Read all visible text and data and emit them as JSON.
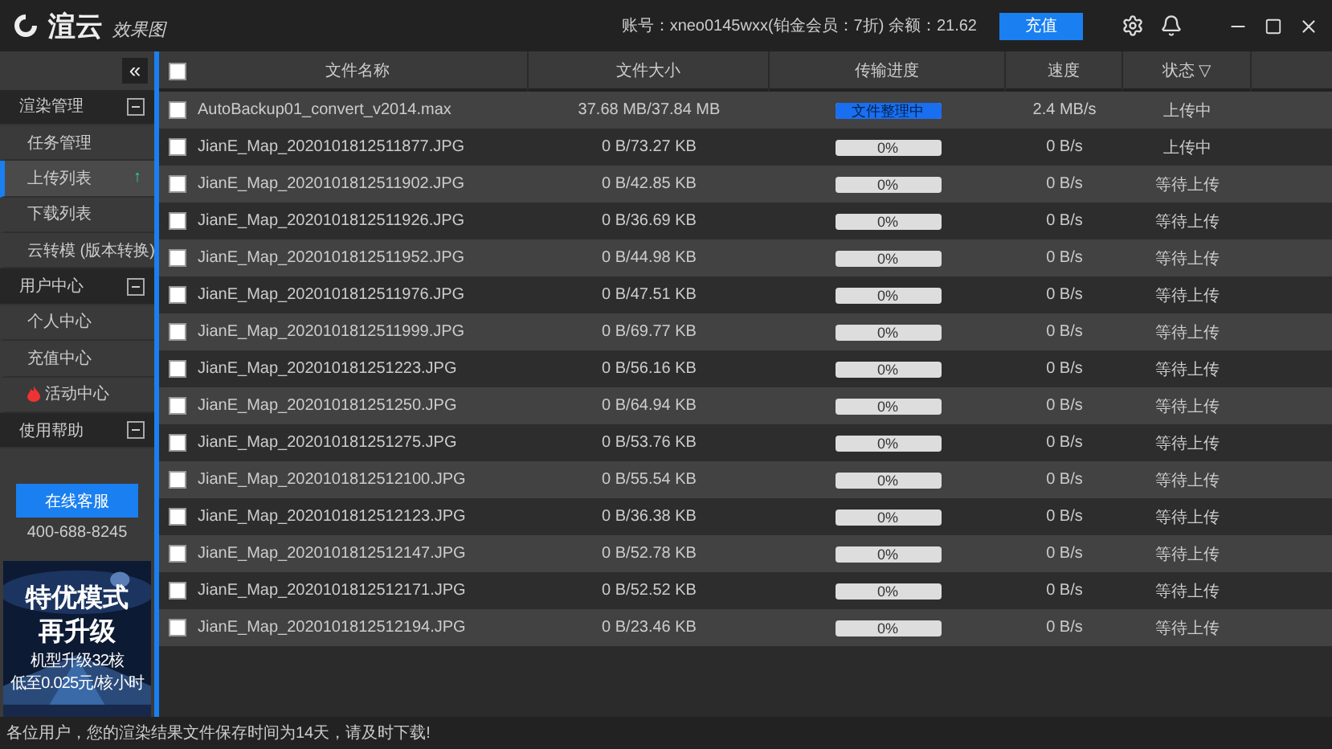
{
  "titlebar": {
    "logo": "渲云",
    "subtitle": "效果图",
    "account": "账号：xneo0145wxx(铂金会员：7折) 余额：21.62",
    "recharge": "充值"
  },
  "sidebar": {
    "collapse": "«",
    "groups": [
      {
        "label": "渲染管理",
        "expanded": true,
        "items": [
          {
            "label": "任务管理",
            "selected": false
          },
          {
            "label": "上传列表",
            "selected": true,
            "badge": "↑"
          },
          {
            "label": "下载列表",
            "selected": false
          },
          {
            "label": "云转模 (版本转换)",
            "selected": false
          }
        ]
      },
      {
        "label": "用户中心",
        "expanded": true,
        "items": [
          {
            "label": "个人中心",
            "selected": false
          },
          {
            "label": "充值中心",
            "selected": false
          },
          {
            "label": "活动中心",
            "selected": false,
            "hot": true
          }
        ]
      },
      {
        "label": "使用帮助",
        "expanded": true
      }
    ],
    "service_button": "在线客服",
    "phone": "400-688-8245",
    "banner": {
      "kind": "picture",
      "title": "特优模式",
      "title2": "再升级",
      "line1": "机型升级32核",
      "line2": "低至0.025元/核小时"
    }
  },
  "table": {
    "all_checked": false,
    "columns": [
      "文件名称",
      "文件大小",
      "传输进度",
      "速度",
      "状态"
    ],
    "filter_icon": "▽",
    "rows": [
      {
        "checked": false,
        "name": "AutoBackup01_convert_v2014.max",
        "size": "37.68 MB/37.84 MB",
        "level": 1,
        "progress": "文件整理中",
        "speed": "2.4 MB/s",
        "status": "上传中"
      },
      {
        "checked": false,
        "name": "JianE_Map_2020101812511877.JPG",
        "size": "0 B/73.27 KB",
        "level": 0,
        "progress": "0%",
        "speed": "0 B/s",
        "status": "上传中"
      },
      {
        "checked": false,
        "name": "JianE_Map_2020101812511902.JPG",
        "size": "0 B/42.85 KB",
        "level": 0,
        "progress": "0%",
        "speed": "0 B/s",
        "status": "等待上传"
      },
      {
        "checked": false,
        "name": "JianE_Map_2020101812511926.JPG",
        "size": "0 B/36.69 KB",
        "level": 0,
        "progress": "0%",
        "speed": "0 B/s",
        "status": "等待上传"
      },
      {
        "checked": false,
        "name": "JianE_Map_2020101812511952.JPG",
        "size": "0 B/44.98 KB",
        "level": 0,
        "progress": "0%",
        "speed": "0 B/s",
        "status": "等待上传"
      },
      {
        "checked": false,
        "name": "JianE_Map_2020101812511976.JPG",
        "size": "0 B/47.51 KB",
        "level": 0,
        "progress": "0%",
        "speed": "0 B/s",
        "status": "等待上传"
      },
      {
        "checked": false,
        "name": "JianE_Map_2020101812511999.JPG",
        "size": "0 B/69.77 KB",
        "level": 0,
        "progress": "0%",
        "speed": "0 B/s",
        "status": "等待上传"
      },
      {
        "checked": false,
        "name": "JianE_Map_202010181251223.JPG",
        "size": "0 B/56.16 KB",
        "level": 0,
        "progress": "0%",
        "speed": "0 B/s",
        "status": "等待上传"
      },
      {
        "checked": false,
        "name": "JianE_Map_202010181251250.JPG",
        "size": "0 B/64.94 KB",
        "level": 0,
        "progress": "0%",
        "speed": "0 B/s",
        "status": "等待上传"
      },
      {
        "checked": false,
        "name": "JianE_Map_202010181251275.JPG",
        "size": "0 B/53.76 KB",
        "level": 0,
        "progress": "0%",
        "speed": "0 B/s",
        "status": "等待上传"
      },
      {
        "checked": false,
        "name": "JianE_Map_2020101812512100.JPG",
        "size": "0 B/55.54 KB",
        "level": 0,
        "progress": "0%",
        "speed": "0 B/s",
        "status": "等待上传"
      },
      {
        "checked": false,
        "name": "JianE_Map_2020101812512123.JPG",
        "size": "0 B/36.38 KB",
        "level": 0,
        "progress": "0%",
        "speed": "0 B/s",
        "status": "等待上传"
      },
      {
        "checked": false,
        "name": "JianE_Map_2020101812512147.JPG",
        "size": "0 B/52.78 KB",
        "level": 0,
        "progress": "0%",
        "speed": "0 B/s",
        "status": "等待上传"
      },
      {
        "checked": false,
        "name": "JianE_Map_2020101812512171.JPG",
        "size": "0 B/52.52 KB",
        "level": 0,
        "progress": "0%",
        "speed": "0 B/s",
        "status": "等待上传"
      },
      {
        "checked": false,
        "name": "JianE_Map_2020101812512194.JPG",
        "size": "0 B/23.46 KB",
        "level": 0,
        "progress": "0%",
        "speed": "0 B/s",
        "status": "等待上传"
      }
    ]
  },
  "status_bar": "各位用户，您的渲染结果文件保存时间为14天，请及时下载!"
}
